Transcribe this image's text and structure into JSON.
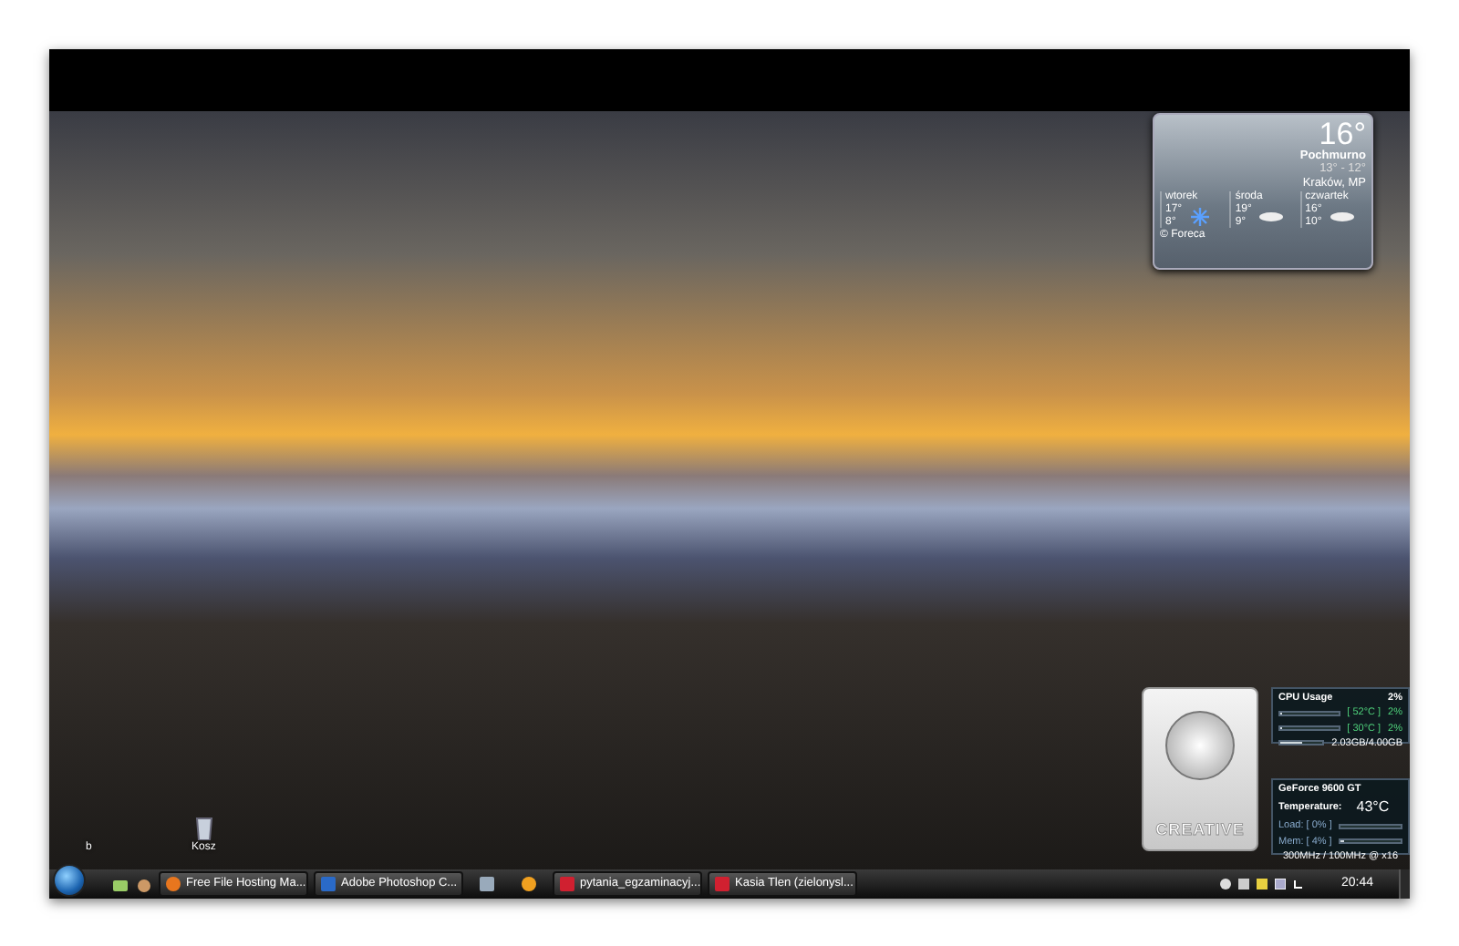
{
  "weather": {
    "temperature": "16°",
    "condition": "Pochmurno",
    "high_low": "13° - 12°",
    "location": "Kraków, MP",
    "forecast": [
      {
        "day": "wtorek",
        "high": "17°",
        "low": "8°",
        "kind": "snow"
      },
      {
        "day": "środa",
        "high": "19°",
        "low": "9°",
        "kind": "cloud"
      },
      {
        "day": "czwartek",
        "high": "16°",
        "low": "10°",
        "kind": "cloud"
      }
    ],
    "credit": "© Foreca"
  },
  "volume_gadget": {
    "brand": "CREATIVE"
  },
  "cpu_gadget": {
    "title": "CPU Usage",
    "total": "2%",
    "cores": [
      {
        "temperature": "[ 52°C ]",
        "usage": "2%",
        "level": 0.02
      },
      {
        "temperature": "[ 30°C ]",
        "usage": "2%",
        "level": 0.02
      }
    ],
    "memory": {
      "reading": "2.03GB/4.00GB",
      "level": 0.5
    }
  },
  "gpu_gadget": {
    "title": "GeForce 9600 GT",
    "temperature_label": "Temperature:",
    "temperature": "43°C",
    "rows": [
      {
        "label": "Load: [ 0% ]",
        "level": 0.0
      },
      {
        "label": "Mem: [ 4% ]",
        "level": 0.04
      }
    ],
    "clocks": "300MHz / 100MHz @ x16"
  },
  "desktop_icons": [
    {
      "label": "b",
      "kind": "blank"
    },
    {
      "label": "Kosz",
      "kind": "recycle"
    }
  ],
  "taskbar": {
    "items": [
      {
        "kind": "button",
        "label": "Free File Hosting Ma..."
      },
      {
        "kind": "button",
        "label": "Adobe Photoshop C..."
      },
      {
        "kind": "icon"
      },
      {
        "kind": "icon"
      },
      {
        "kind": "button",
        "label": "pytania_egzaminacyj..."
      },
      {
        "kind": "button",
        "label": "Kasia Tlen (zielonysl..."
      }
    ],
    "clock": "20:44"
  }
}
